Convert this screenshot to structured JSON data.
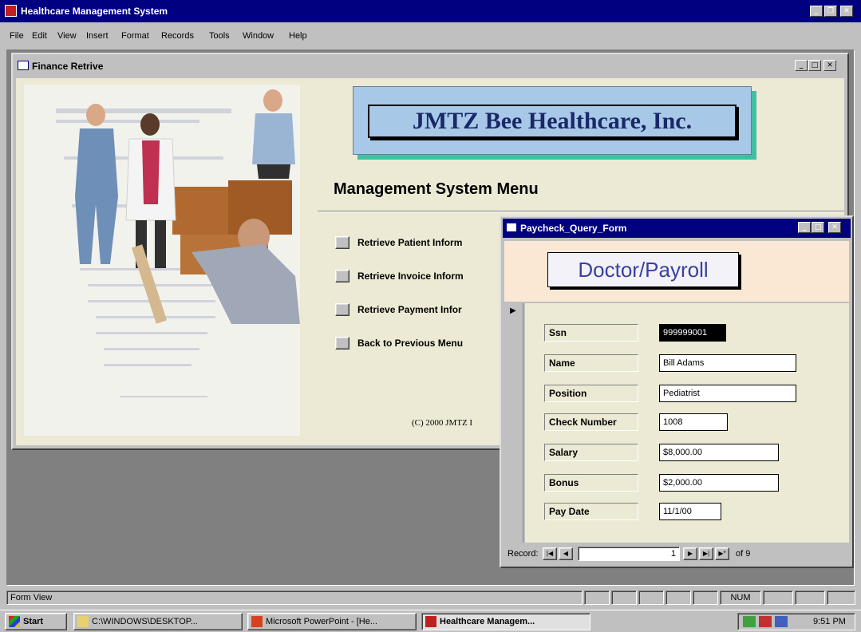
{
  "app": {
    "title": "Healthcare Management System"
  },
  "menubar": [
    "File",
    "Edit",
    "View",
    "Insert",
    "Format",
    "Records",
    "Tools",
    "Window",
    "Help"
  ],
  "finance_window": {
    "title": "Finance Retrive",
    "brand": "JMTZ Bee Healthcare, Inc.",
    "menu_heading": "Management System Menu",
    "buttons": [
      "Retrieve Patient Inform",
      "Retrieve Invoice Inform",
      "Retrieve Payment Infor",
      "Back to Previous Menu"
    ],
    "copyright": "(C) 2000 JMTZ I"
  },
  "paycheck_window": {
    "title": "Paycheck_Query_Form",
    "header": "Doctor/Payroll",
    "fields": [
      {
        "label": "Ssn",
        "value": "999999001"
      },
      {
        "label": "Name",
        "value": "Bill Adams"
      },
      {
        "label": "Position",
        "value": "Pediatrist"
      },
      {
        "label": "Check Number",
        "value": "1008"
      },
      {
        "label": "Salary",
        "value": "$8,000.00"
      },
      {
        "label": "Bonus",
        "value": "$2,000.00"
      },
      {
        "label": "Pay Date",
        "value": "11/1/00"
      }
    ],
    "nav": {
      "record_label": "Record:",
      "current": "1",
      "of_label": "of 9"
    }
  },
  "statusbar": {
    "left": "Form View",
    "num": "NUM"
  },
  "taskbar": {
    "start": "Start",
    "tasks": [
      "C:\\WINDOWS\\DESKTOP...",
      "Microsoft PowerPoint - [He...",
      "Healthcare Managem..."
    ],
    "clock": "9:51 PM"
  }
}
